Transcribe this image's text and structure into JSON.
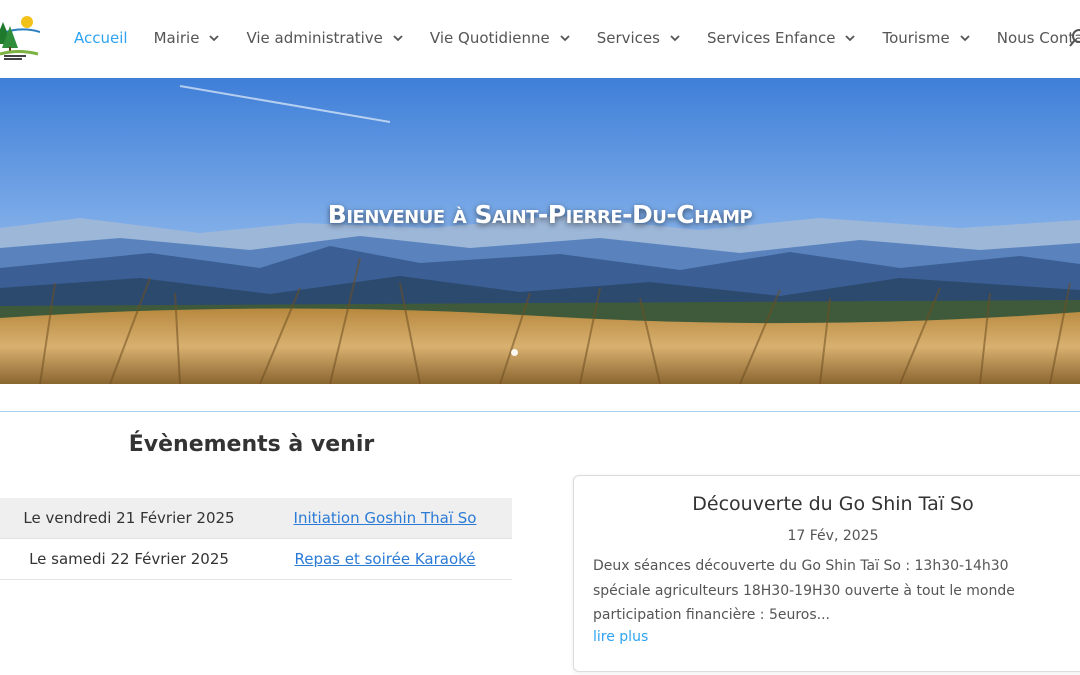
{
  "header": {
    "nav": [
      {
        "label": "Accueil",
        "active": true,
        "has_menu": false
      },
      {
        "label": "Mairie",
        "active": false,
        "has_menu": true
      },
      {
        "label": "Vie administrative",
        "active": false,
        "has_menu": true
      },
      {
        "label": "Vie Quotidienne",
        "active": false,
        "has_menu": true
      },
      {
        "label": "Services",
        "active": false,
        "has_menu": true
      },
      {
        "label": "Services Enfance",
        "active": false,
        "has_menu": true
      },
      {
        "label": "Tourisme",
        "active": false,
        "has_menu": true
      },
      {
        "label": "Nous Contacter",
        "active": false,
        "has_menu": false
      }
    ],
    "icons": {
      "search": "search-icon",
      "submenu": "chevron-down-icon"
    }
  },
  "hero": {
    "title": "Bienvenue à Saint-Pierre-Du-Champ",
    "slides": 1,
    "active_slide": 1
  },
  "events": {
    "title": "Évènements à venir",
    "rows": [
      {
        "date": "Le vendredi 21 Février 2025",
        "name": "Initiation Goshin Thaï So"
      },
      {
        "date": "Le samedi 22 Février 2025",
        "name": "Repas et soirée Karaoké"
      }
    ]
  },
  "news": {
    "title": "Découverte du Go Shin Taï So",
    "date": "17 Fév, 2025",
    "excerpt": "Deux séances découverte du Go Shin Taï So : 13h30-14h30 spéciale agriculteurs 18H30-19H30 ouverte à tout le monde participation financière : 5euros...",
    "more_label": "lire plus"
  },
  "colors": {
    "accent": "#2ea3f2",
    "link": "#2b7bd6",
    "text": "#333333",
    "divider": "#a9d3ec"
  }
}
